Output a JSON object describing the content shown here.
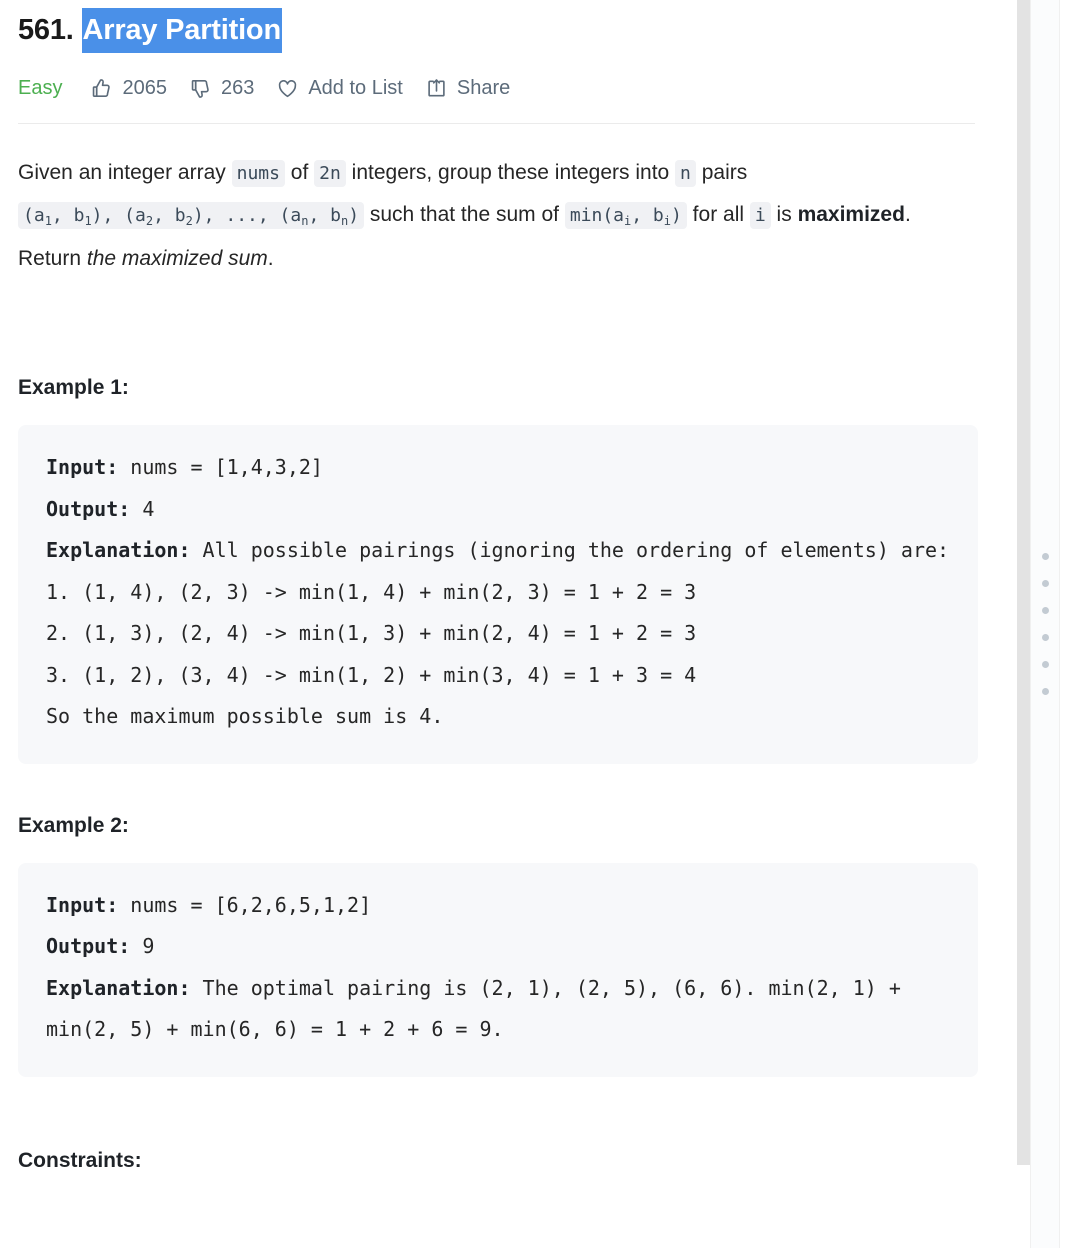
{
  "problem": {
    "number": "561.",
    "title": "Array Partition",
    "title_selected": true,
    "selection_color": "#4a90e8"
  },
  "meta": {
    "difficulty": "Easy",
    "difficulty_color": "#4caf50",
    "likes": "2065",
    "dislikes": "263",
    "add_to_list_label": "Add to List",
    "share_label": "Share",
    "icons": {
      "like": "thumbs-up-icon",
      "dislike": "thumbs-down-icon",
      "favorite": "heart-icon",
      "share": "share-icon"
    }
  },
  "description": {
    "part1": "Given an integer array ",
    "code_nums": "nums",
    "part2": " of ",
    "code_2n": "2n",
    "part3": " integers, group these integers into ",
    "code_n": "n",
    "part4": " pairs ",
    "code_pairs_a1": "(a",
    "code_pairs_sub1": "1",
    "code_pairs_b1": ", b",
    "code_pairs_sub1b": "1",
    "code_pairs_close1": "), (a",
    "code_pairs_sub2": "2",
    "code_pairs_b2": ", b",
    "code_pairs_sub2b": "2",
    "code_pairs_close2": "), ..., (a",
    "code_pairs_subn": "n",
    "code_pairs_bn": ", b",
    "code_pairs_subnb": "n",
    "code_pairs_close3": ")",
    "part5": " such that the sum of ",
    "code_min_open": "min(a",
    "code_min_subi": "i",
    "code_min_b": ", b",
    "code_min_subib": "i",
    "code_min_close": ")",
    "part6": " for all ",
    "code_i": "i",
    "part7": " is ",
    "bold_maximized": "maximized",
    "part8": ". Return ",
    "italic_tail": "the maximized sum",
    "part9": "."
  },
  "examples": [
    {
      "heading": "Example 1:",
      "input_label": "Input:",
      "input_value": " nums = [1,4,3,2]",
      "output_label": "Output:",
      "output_value": " 4",
      "explanation_label": "Explanation:",
      "explanation_value": " All possible pairings (ignoring the ordering of elements) are:\n1. (1, 4), (2, 3) -> min(1, 4) + min(2, 3) = 1 + 2 = 3\n2. (1, 3), (2, 4) -> min(1, 3) + min(2, 4) = 1 + 2 = 3\n3. (1, 2), (3, 4) -> min(1, 2) + min(3, 4) = 1 + 3 = 4\nSo the maximum possible sum is 4."
    },
    {
      "heading": "Example 2:",
      "input_label": "Input:",
      "input_value": " nums = [6,2,6,5,1,2]",
      "output_label": "Output:",
      "output_value": " 9",
      "explanation_label": "Explanation:",
      "explanation_value": " The optimal pairing is (2, 1), (2, 5), (6, 6). min(2, 1) + min(2, 5) + min(6, 6) = 1 + 2 + 6 = 9."
    }
  ],
  "constraints": {
    "heading": "Constraints:"
  },
  "chrome": {
    "scrollbar_color": "#e3e3e3",
    "resizer_dot_color": "#c3cbd3",
    "resizer_dot_count": 6,
    "code_block_bg": "#f7f8fa",
    "inline_code_bg": "#f0f1f4"
  }
}
